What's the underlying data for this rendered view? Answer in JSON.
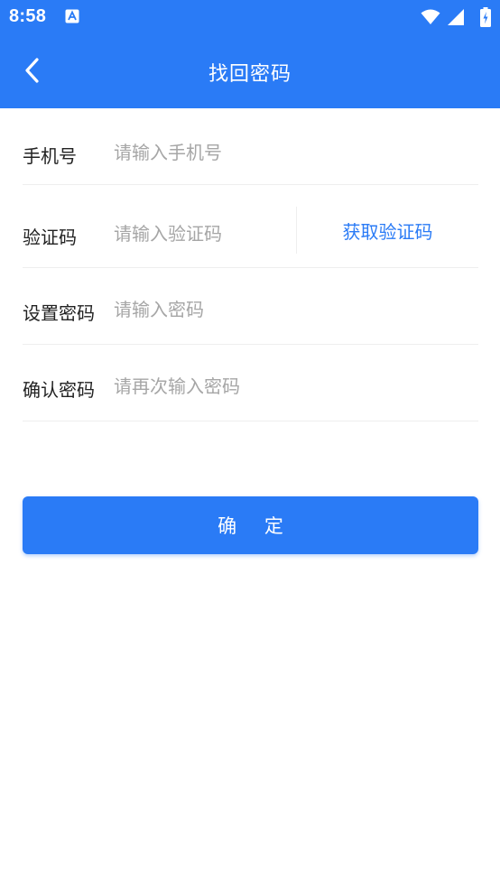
{
  "status_bar": {
    "time": "8:58",
    "icons": [
      "notification-a-icon",
      "wifi-icon",
      "signal-icon",
      "battery-icon"
    ]
  },
  "header": {
    "title": "找回密码",
    "back_icon": "chevron-left-icon"
  },
  "form": {
    "phone": {
      "label": "手机号",
      "placeholder": "请输入手机号",
      "value": ""
    },
    "code": {
      "label": "验证码",
      "placeholder": "请输入验证码",
      "value": "",
      "get_code_label": "获取验证码"
    },
    "password": {
      "label": "设置密码",
      "placeholder": "请输入密码",
      "value": ""
    },
    "confirm_password": {
      "label": "确认密码",
      "placeholder": "请再次输入密码",
      "value": ""
    }
  },
  "actions": {
    "submit_label": "确 定"
  },
  "colors": {
    "primary": "#2a7bf6",
    "text": "#222222",
    "placeholder": "#a6a6a6",
    "divider": "#eeeeee",
    "background": "#ffffff"
  }
}
